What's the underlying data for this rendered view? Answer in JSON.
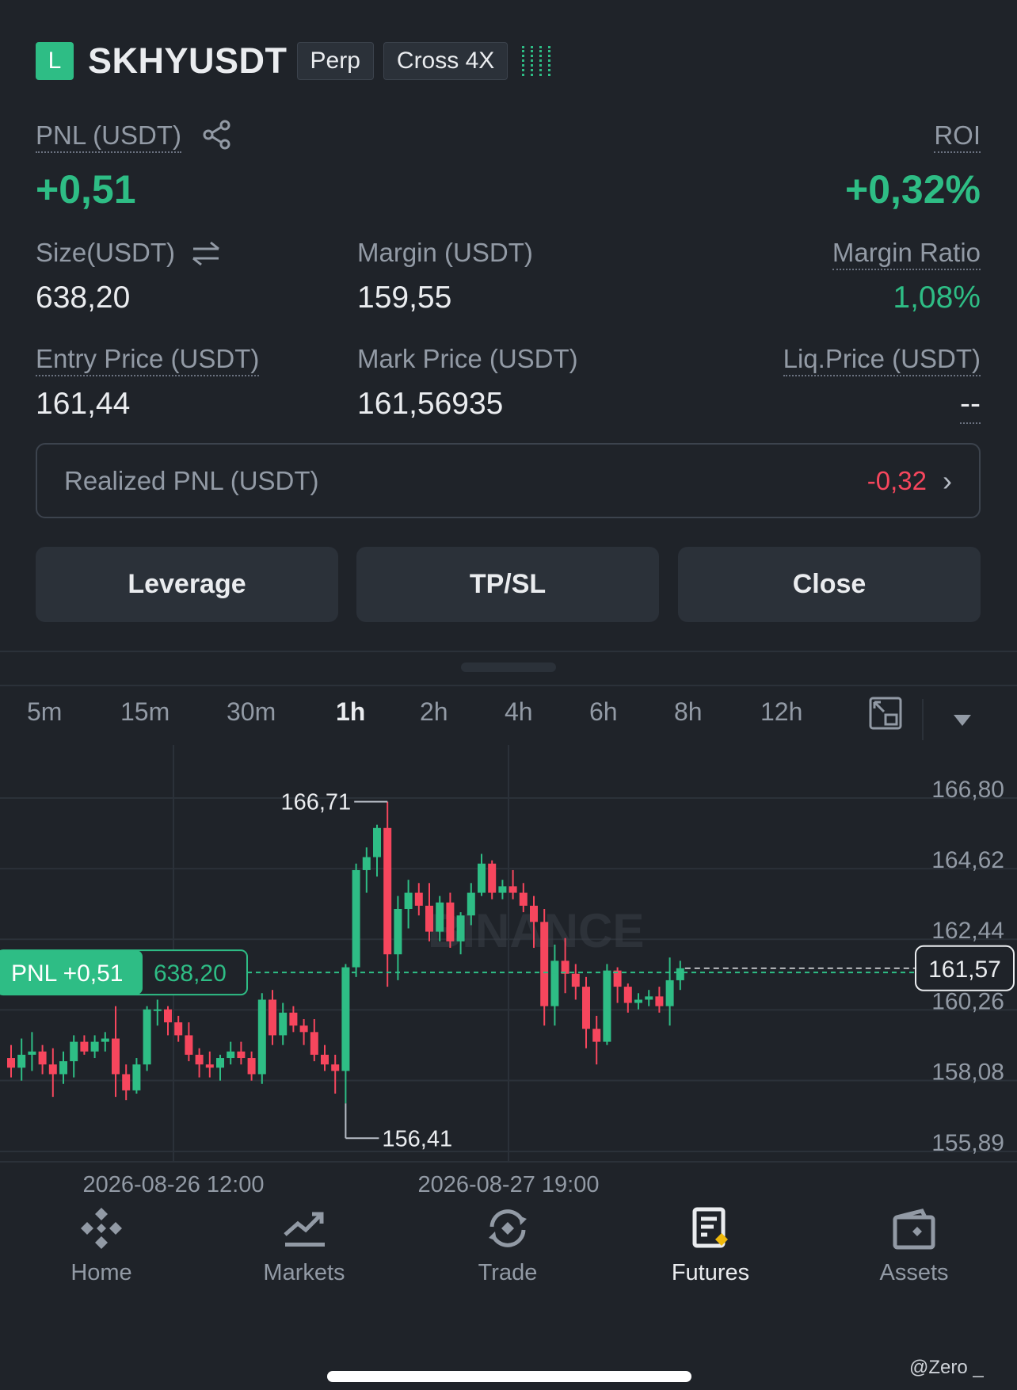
{
  "header": {
    "side": "L",
    "symbol": "SKHYUSDT",
    "type_tag": "Perp",
    "margin_tag": "Cross 4X"
  },
  "position": {
    "pnl_label": "PNL (USDT)",
    "pnl_value": "+0,51",
    "roi_label": "ROI",
    "roi_value": "+0,32%",
    "size_label": "Size(USDT)",
    "size_value": "638,20",
    "margin_label": "Margin (USDT)",
    "margin_value": "159,55",
    "margin_ratio_label": "Margin Ratio",
    "margin_ratio_value": "1,08%",
    "entry_label": "Entry Price (USDT)",
    "entry_value": "161,44",
    "mark_label": "Mark Price (USDT)",
    "mark_value": "161,56935",
    "liq_label": "Liq.Price (USDT)",
    "liq_value": "--",
    "realized_label": "Realized PNL (USDT)",
    "realized_value": "-0,32"
  },
  "actions": {
    "leverage": "Leverage",
    "tpsl": "TP/SL",
    "close": "Close"
  },
  "timeframes": [
    "5m",
    "15m",
    "30m",
    "1h",
    "2h",
    "4h",
    "6h",
    "8h",
    "12h"
  ],
  "active_timeframe": "1h",
  "chart_data": {
    "type": "candlestick",
    "y_ticks": [
      "166,80",
      "164,62",
      "162,44",
      "160,26",
      "158,08",
      "155,89"
    ],
    "ylim": [
      155.89,
      166.8
    ],
    "x_ticks": [
      "2026-08-26 12:00",
      "2026-08-27 19:00"
    ],
    "high_label": "166,71",
    "low_label": "156,41",
    "current_price_label": "161,57",
    "position_tag_pnl": "PNL +0,51",
    "position_tag_size": "638,20",
    "watermark": "BINANCE",
    "colors": {
      "up": "#2ebd85",
      "down": "#f6465d"
    },
    "candles": [
      [
        158.8,
        159.2,
        158.2,
        158.5
      ],
      [
        158.5,
        159.4,
        158.1,
        158.9
      ],
      [
        158.9,
        159.6,
        158.4,
        159.0
      ],
      [
        159.0,
        159.2,
        158.3,
        158.6
      ],
      [
        158.6,
        159.1,
        157.6,
        158.3
      ],
      [
        158.3,
        159.0,
        158.0,
        158.7
      ],
      [
        158.7,
        159.5,
        158.2,
        159.3
      ],
      [
        159.3,
        159.5,
        158.9,
        159.0
      ],
      [
        159.0,
        159.5,
        158.8,
        159.3
      ],
      [
        159.3,
        159.6,
        159.0,
        159.4
      ],
      [
        159.4,
        160.4,
        157.6,
        158.3
      ],
      [
        158.3,
        158.6,
        157.5,
        157.8
      ],
      [
        157.8,
        158.8,
        157.7,
        158.6
      ],
      [
        158.6,
        160.4,
        158.4,
        160.3
      ],
      [
        160.3,
        160.6,
        159.8,
        160.3
      ],
      [
        160.3,
        160.4,
        159.5,
        159.9
      ],
      [
        159.9,
        160.1,
        159.3,
        159.5
      ],
      [
        159.5,
        159.9,
        158.7,
        158.9
      ],
      [
        158.9,
        159.1,
        158.2,
        158.6
      ],
      [
        158.6,
        159.0,
        158.2,
        158.5
      ],
      [
        158.5,
        158.9,
        158.1,
        158.8
      ],
      [
        158.8,
        159.3,
        158.6,
        159.0
      ],
      [
        159.0,
        159.3,
        158.6,
        158.8
      ],
      [
        158.8,
        159.0,
        158.1,
        158.3
      ],
      [
        158.3,
        160.8,
        158.0,
        160.6
      ],
      [
        160.6,
        160.9,
        159.2,
        159.5
      ],
      [
        159.5,
        160.5,
        159.2,
        160.2
      ],
      [
        160.2,
        160.4,
        159.6,
        159.8
      ],
      [
        159.8,
        160.0,
        159.2,
        159.6
      ],
      [
        159.6,
        160.0,
        158.7,
        158.9
      ],
      [
        158.9,
        159.2,
        158.4,
        158.6
      ],
      [
        158.6,
        158.9,
        157.7,
        158.4
      ],
      [
        158.4,
        161.7,
        157.4,
        161.6
      ],
      [
        161.6,
        164.8,
        161.3,
        164.6
      ],
      [
        164.6,
        165.3,
        163.9,
        165.0
      ],
      [
        165.0,
        166.0,
        164.4,
        165.9
      ],
      [
        165.9,
        166.71,
        161.0,
        162.0
      ],
      [
        162.0,
        163.8,
        161.2,
        163.4
      ],
      [
        163.4,
        164.3,
        162.8,
        163.9
      ],
      [
        163.9,
        164.2,
        163.2,
        163.5
      ],
      [
        163.5,
        164.2,
        162.4,
        162.7
      ],
      [
        162.7,
        163.8,
        162.4,
        163.6
      ],
      [
        163.6,
        163.9,
        162.2,
        162.4
      ],
      [
        162.4,
        163.3,
        162.0,
        163.2
      ],
      [
        163.2,
        164.2,
        162.9,
        163.9
      ],
      [
        163.9,
        165.1,
        163.8,
        164.8
      ],
      [
        164.8,
        164.9,
        163.7,
        163.9
      ],
      [
        163.9,
        164.3,
        163.7,
        164.1
      ],
      [
        164.1,
        164.6,
        163.7,
        163.9
      ],
      [
        163.9,
        164.2,
        163.3,
        163.5
      ],
      [
        163.5,
        163.8,
        162.2,
        163.0
      ],
      [
        163.0,
        163.4,
        159.8,
        160.4
      ],
      [
        160.4,
        162.3,
        159.8,
        161.8
      ],
      [
        161.8,
        162.5,
        160.8,
        161.4
      ],
      [
        161.4,
        161.7,
        160.6,
        161.0
      ],
      [
        161.0,
        161.3,
        159.1,
        159.7
      ],
      [
        159.7,
        160.1,
        158.6,
        159.3
      ],
      [
        159.3,
        161.7,
        159.2,
        161.5
      ],
      [
        161.5,
        161.6,
        160.5,
        161.0
      ],
      [
        161.0,
        161.1,
        160.2,
        160.5
      ],
      [
        160.5,
        160.8,
        160.3,
        160.6
      ],
      [
        160.6,
        160.9,
        160.4,
        160.7
      ],
      [
        160.7,
        161.0,
        160.2,
        160.4
      ],
      [
        160.4,
        161.9,
        159.8,
        161.2
      ],
      [
        161.2,
        161.8,
        160.9,
        161.57
      ]
    ]
  },
  "nav": [
    {
      "label": "Home",
      "icon": "home-icon"
    },
    {
      "label": "Markets",
      "icon": "markets-icon"
    },
    {
      "label": "Trade",
      "icon": "trade-icon"
    },
    {
      "label": "Futures",
      "icon": "futures-icon"
    },
    {
      "label": "Assets",
      "icon": "assets-icon"
    }
  ],
  "active_nav": "Futures",
  "watermark_corner": "@Zero _"
}
